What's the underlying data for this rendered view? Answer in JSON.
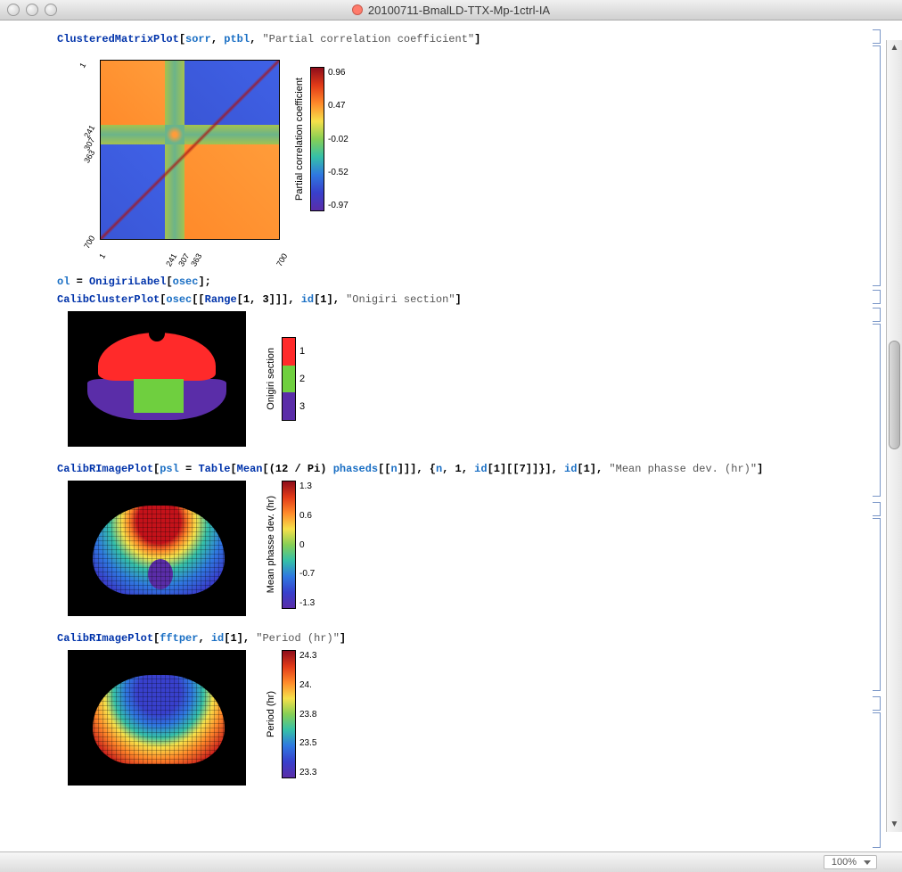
{
  "window": {
    "title": "20100711-BmalLD-TTX-Mp-1ctrl-IA",
    "unsaved": true
  },
  "statusbar": {
    "zoom": "100%"
  },
  "cells": {
    "c1": {
      "tokens": {
        "fn": "ClusteredMatrixPlot",
        "v1": "sorr",
        "v2": "ptbl",
        "str": "\"Partial correlation coefficient\""
      }
    },
    "c2": {
      "tokens": {
        "v": "ol",
        "fn": "OnigiriLabel",
        "a": "osec"
      }
    },
    "c3": {
      "tokens": {
        "fn": "CalibClusterPlot",
        "v1": "osec",
        "rng": "Range",
        "r": "[1, 3]",
        "v2": "id",
        "idx": "[1]",
        "str": "\"Onigiri section\""
      }
    },
    "c4": {
      "tokens": {
        "fn": "CalibRImagePlot",
        "v1": "psl",
        "tbl": "Table",
        "mean": "Mean",
        "frac": "(12 / Pi)",
        "ph": "phaseds",
        "n1": "n",
        "n2": "n",
        "id": "id",
        "idx7": "[1][[7]]",
        "idx1": "[1]",
        "str": "\"Mean phasse dev. (hr)\""
      }
    },
    "c5": {
      "tokens": {
        "fn": "CalibRImagePlot",
        "v1": "fftper",
        "id": "id",
        "idx1": "[1]",
        "str": "\"Period (hr)\""
      }
    }
  },
  "chart_data": [
    {
      "type": "heatmap",
      "title": "Partial correlation coefficient",
      "xlabel": "",
      "ylabel": "",
      "x_ticks": [
        "1",
        "241",
        "307",
        "363",
        "700"
      ],
      "y_ticks": [
        "1",
        "241",
        "307",
        "363",
        "700"
      ],
      "colorbar_label": "Partial correlation coefficient",
      "colorbar_ticks": [
        "0.96",
        "0.47",
        "-0.02",
        "-0.52",
        "-0.97"
      ],
      "zlim": [
        -0.97,
        0.96
      ],
      "note": "Clustered partial-correlation matrix; two anti-correlated blocks separated by a mixed band around indices 241–363; diagonal ≈ 0.96."
    },
    {
      "type": "heatmap",
      "title": "Onigiri section",
      "colorbar_label": "Onigiri section",
      "categories": [
        "1",
        "2",
        "3"
      ],
      "colors": {
        "1": "#ff2a2a",
        "2": "#6fcf3f",
        "3": "#5a2da8"
      },
      "note": "Categorical mask: region 1 upper lobe, region 2 central block, region 3 lower flanks."
    },
    {
      "type": "heatmap",
      "title": "Mean phasse dev. (hr)",
      "colorbar_label": "Mean phasse dev. (hr)",
      "colorbar_ticks": [
        "1.3",
        "0.6",
        "0",
        "-0.7",
        "-1.3"
      ],
      "zlim": [
        -1.3,
        1.3
      ],
      "note": "Dorsal region ≈ +1.0 to +1.3 hr; ventral/lateral ≈ -0.7 to -1.3 hr."
    },
    {
      "type": "heatmap",
      "title": "Period (hr)",
      "colorbar_label": "Period (hr)",
      "colorbar_ticks": [
        "24.3",
        "24.",
        "23.8",
        "23.5",
        "23.3"
      ],
      "zlim": [
        23.3,
        24.3
      ],
      "note": "Dorsal center ≈ 23.3–23.5 hr; ventral/peripheral ≈ 24.0–24.3 hr."
    }
  ]
}
